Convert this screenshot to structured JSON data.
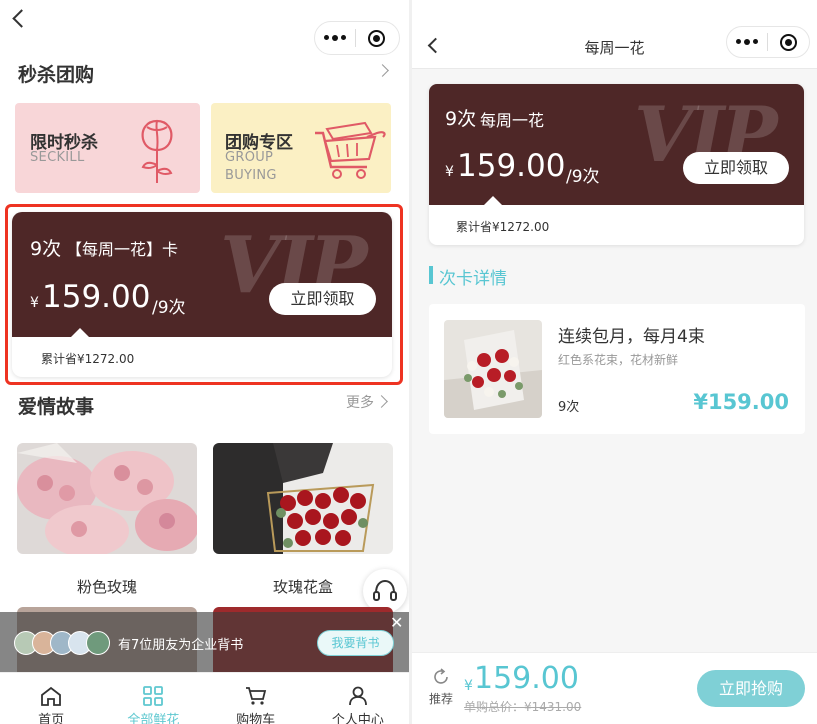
{
  "left": {
    "section_seckill": "秒杀团购",
    "promo_seckill": {
      "title": "限时秒杀",
      "subtitle": "SECKILL"
    },
    "promo_group": {
      "title": "团购专区",
      "subtitle_1": "GROUP",
      "subtitle_2": "BUYING"
    },
    "vip_card": {
      "count": "9次",
      "name": "【每周一花】卡",
      "currency": "¥",
      "price": "159.00",
      "unit": "/9次",
      "button": "立即领取",
      "watermark": "VIP",
      "savings": "累计省¥1272.00"
    },
    "section_love": "爱情故事",
    "more": "更多",
    "products": [
      "粉色玫瑰",
      "玫瑰花盒"
    ],
    "endorse_text": "有7位朋友为企业背书",
    "endorse_button": "我要背书",
    "tabs": [
      "首页",
      "全部鲜花",
      "购物车",
      "个人中心"
    ]
  },
  "right": {
    "title": "每周一花",
    "vip_card": {
      "count": "9次",
      "name": "每周一花",
      "currency": "¥",
      "price": "159.00",
      "unit": "/9次",
      "button": "立即领取",
      "watermark": "VIP",
      "savings": "累计省¥1272.00"
    },
    "detail_heading": "次卡详情",
    "detail": {
      "name": "连续包月，每月4束",
      "desc": "红色系花束，花材新鲜",
      "count": "9次",
      "price": "¥159.00"
    },
    "footer": {
      "recommend": "推荐",
      "currency": "¥",
      "price": "159.00",
      "original": "单购总价：¥1431.00",
      "button": "立即抢购"
    }
  },
  "colors": {
    "vip_bg": "#4e2727",
    "teal": "#58c6d2",
    "highlight_border": "#ee3322"
  }
}
